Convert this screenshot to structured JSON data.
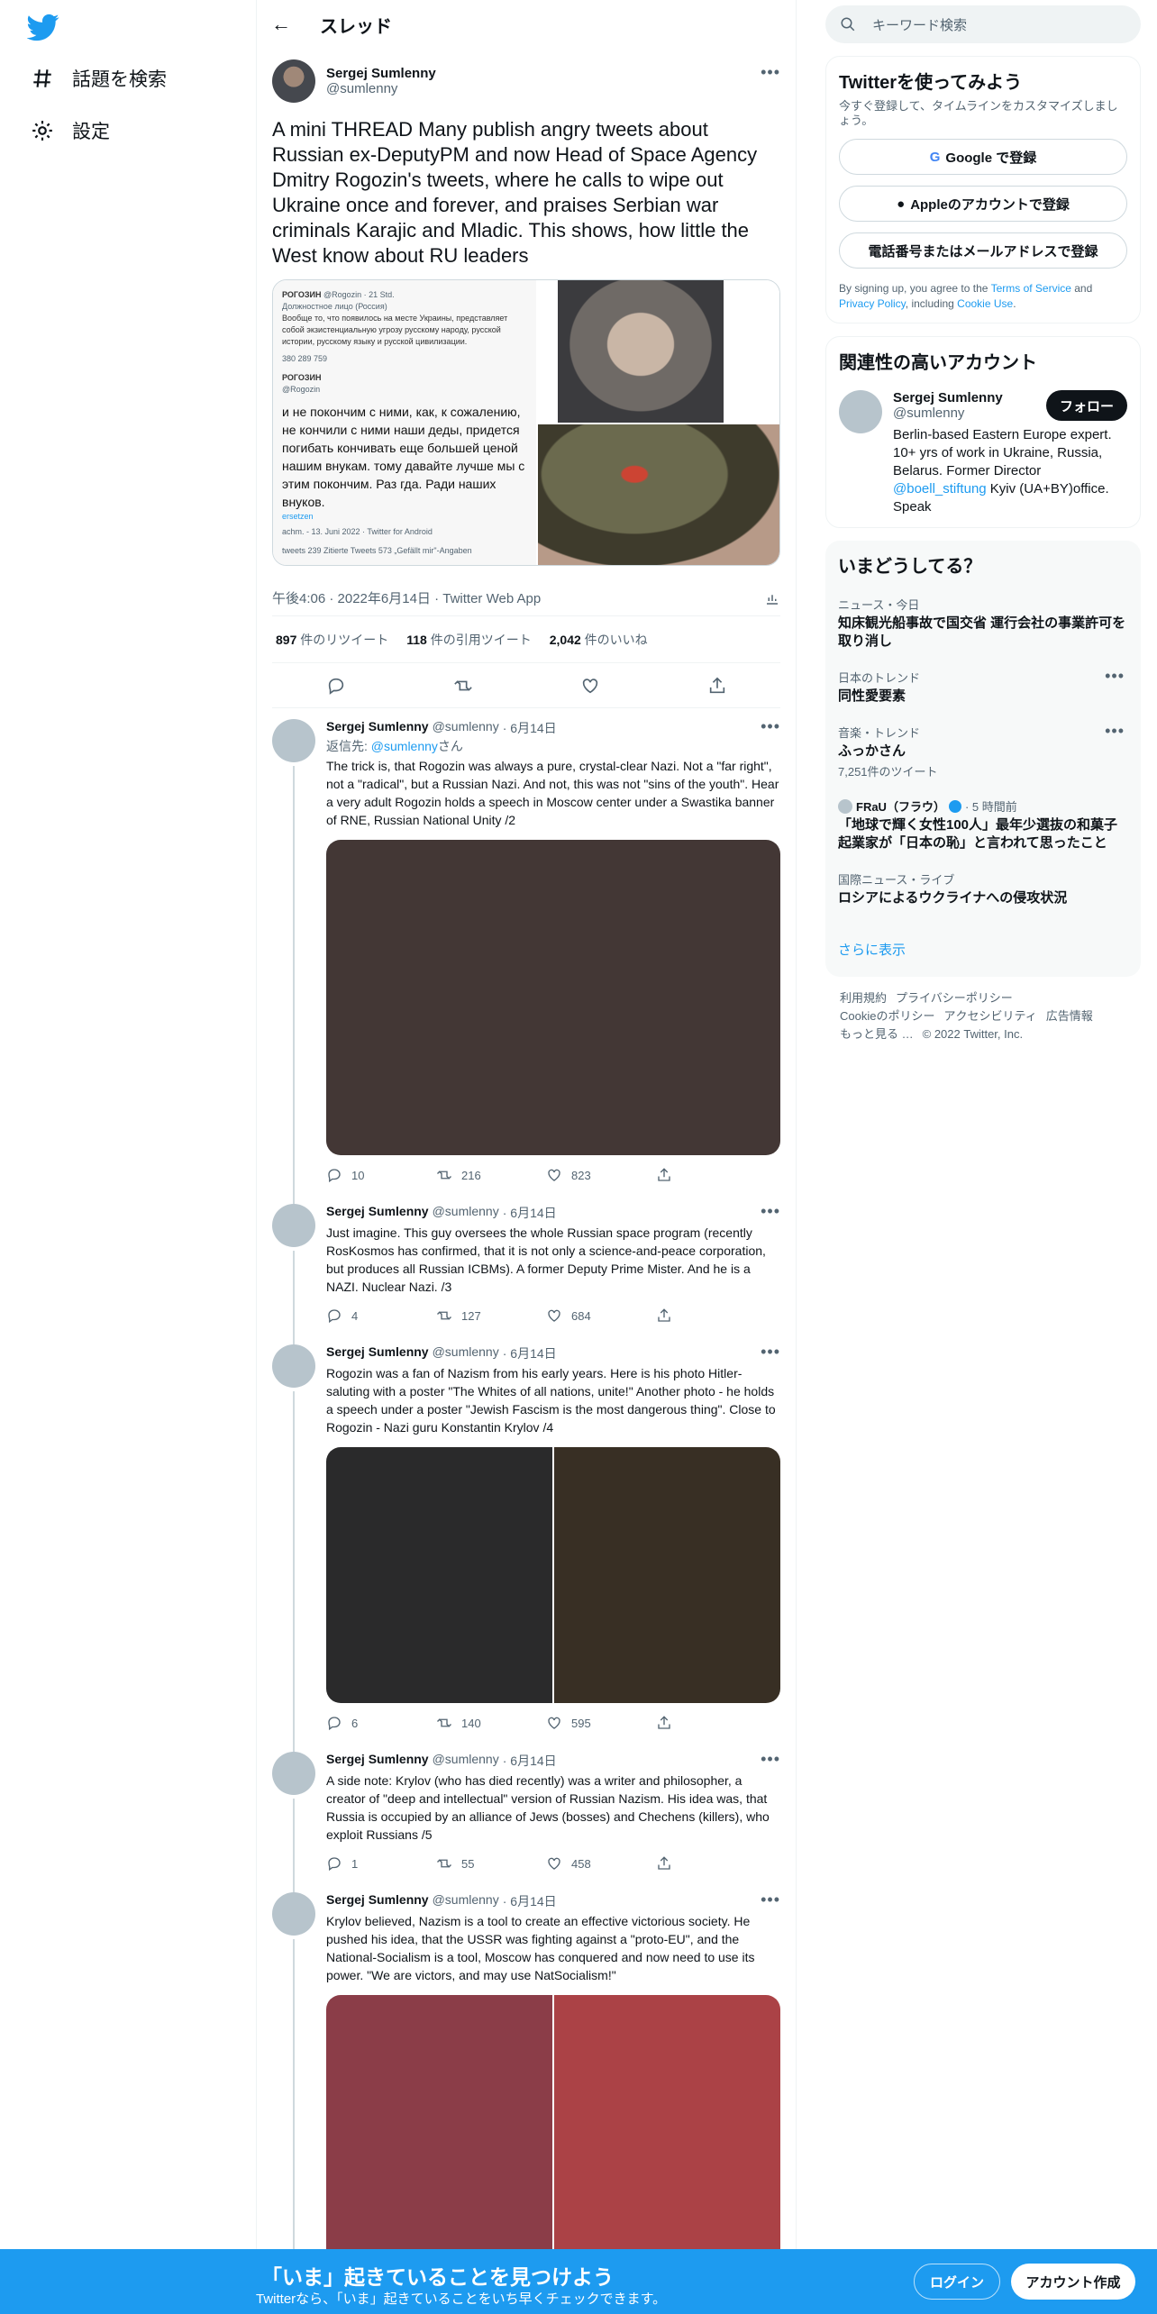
{
  "nav": {
    "explore_label": "話題を検索",
    "settings_label": "設定"
  },
  "header": {
    "title": "スレッド"
  },
  "main_tweet": {
    "name": "Sergej Sumlenny",
    "handle": "@sumlenny",
    "text": "A mini THREAD Many publish angry tweets about Russian ex-DeputyPM and now Head of Space Agency Dmitry Rogozin's tweets, where he calls to wipe out Ukraine once and forever, and praises Serbian war criminals Karajic and Mladic. This shows, how little the West know about RU leaders",
    "media_text": {
      "author": "РОГОЗИН",
      "handle_time": "@Rogozin · 21 Std.",
      "label": "Должностное лицо (Россия)",
      "body": "Вообще то, что появилось на месте Украины, представляет собой экзистенциальную угрозу русскому народу, русской истории, русскому языку и русской цивилизации.",
      "counts": "380   289   759",
      "author2": "РОГОЗИН",
      "handle2": "@Rogozin",
      "big": "и не покончим с ними, как, к сожалению, не кончили с ними наши деды, придется погибать кончивать еще большей ценой нашим внукам. тому давайте лучше мы с этим покончим. Раз гда. Ради наших внуков.",
      "link": "ersetzen",
      "date": "achm. - 13. Juni 2022 · Twitter for Android",
      "foot": "tweets   239 Zitierte Tweets   573 „Gefällt mir\"-Angaben"
    },
    "timestamp": "午後4:06 · 2022年6月14日 · Twitter Web App",
    "retweets": "897",
    "retweets_label": "件のリツイート",
    "quotes": "118",
    "quotes_label": "件の引用ツイート",
    "likes": "2,042",
    "likes_label": "件のいいね"
  },
  "replies": [
    {
      "name": "Sergej Sumlenny",
      "handle": "@sumlenny",
      "date": "· 6月14日",
      "replying_prefix": "返信先: ",
      "replying_handle": "@sumlenny",
      "replying_suffix": "さん",
      "text": "The trick is, that Rogozin was always a pure, crystal-clear Nazi. Not a \"far right\", not a \"radical\", but a Russian Nazi. And not, this was not \"sins of the youth\". Hear a very adult Rogozin holds a speech in Moscow center under a Swastika banner of RNE, Russian National Unity /2",
      "reply_count": "10",
      "retweet_count": "216",
      "like_count": "823"
    },
    {
      "name": "Sergej Sumlenny",
      "handle": "@sumlenny",
      "date": "· 6月14日",
      "text": "Just imagine. This guy oversees the whole Russian space program (recently RosKosmos has confirmed, that it is not only a science-and-peace corporation, but produces all Russian ICBMs). A former Deputy Prime Mister. And he is a NAZI. Nuclear Nazi. /3",
      "reply_count": "4",
      "retweet_count": "127",
      "like_count": "684"
    },
    {
      "name": "Sergej Sumlenny",
      "handle": "@sumlenny",
      "date": "· 6月14日",
      "text": "Rogozin was a fan of Nazism from his early years. Here is his photo Hitler-saluting with a poster \"The Whites of all nations, unite!\" Another photo - he holds a speech under a poster \"Jewish Fascism is the most dangerous thing\". Close to Rogozin - Nazi guru Konstantin Krylov /4",
      "reply_count": "6",
      "retweet_count": "140",
      "like_count": "595"
    },
    {
      "name": "Sergej Sumlenny",
      "handle": "@sumlenny",
      "date": "· 6月14日",
      "text": "A side note: Krylov (who has died recently) was a writer and philosopher, a creator of \"deep and intellectual\" version of Russian Nazism. His idea was, that Russia is occupied by an alliance of Jews (bosses) and Chechens (killers), who exploit Russians /5",
      "reply_count": "1",
      "retweet_count": "55",
      "like_count": "458"
    },
    {
      "name": "Sergej Sumlenny",
      "handle": "@sumlenny",
      "date": "· 6月14日",
      "text": "Krylov believed, Nazism is a tool to create an effective victorious society. He pushed his idea, that the USSR was fighting against a \"proto-EU\", and the National-Socialism is a tool, Moscow has conquered and now need to use its power. \"We are victors, and may use NatSocialism!\""
    }
  ],
  "right": {
    "search_placeholder": "キーワード検索",
    "signup": {
      "title": "Twitterを使ってみよう",
      "subtitle": "今すぐ登録して、タイムラインをカスタマイズしましょう。",
      "google": "Google で登録",
      "apple": "Appleのアカウントで登録",
      "phone": "電話番号またはメールアドレスで登録",
      "legal_prefix": "By signing up, you agree to the ",
      "terms": "Terms of Service",
      "and": " and ",
      "privacy": "Privacy Policy",
      "including": ", including ",
      "cookie": "Cookie Use",
      "period": "."
    },
    "related": {
      "title": "関連性の高いアカウント",
      "name": "Sergej Sumlenny",
      "handle": "@sumlenny",
      "follow": "フォロー",
      "bio_a": "Berlin-based      Eastern Europe expert. 10+ yrs of work in Ukraine, Russia, Belarus. Former Director ",
      "bio_link": "@boell_stiftung",
      "bio_b": " Kyiv (UA+BY)office. Speak"
    },
    "trends": {
      "title": "いまどうしてる？",
      "items": [
        {
          "category": "ニュース・今日",
          "title": "知床観光船事故で国交省 運行会社の事業許可を取り消し"
        },
        {
          "category": "日本のトレンド",
          "title": "同性愛要素"
        },
        {
          "category": "音楽・トレンド",
          "title": "ふっかさん",
          "count": "7,251件のツイート"
        },
        {
          "category": "FRaU（フラウ）",
          "time": "· 5 時間前",
          "title": "「地球で輝く女性100人」最年少選抜の和菓子起業家が「日本の恥」と言われて思ったこと"
        },
        {
          "category": "国際ニュース・ライブ",
          "title": "ロシアによるウクライナへの侵攻状況"
        }
      ],
      "show_more": "さらに表示"
    },
    "footer": {
      "terms": "利用規約",
      "privacy": "プライバシーポリシー",
      "cookie": "Cookieのポリシー",
      "access": "アクセシビリティ",
      "ads": "広告情報",
      "more": "もっと見る …",
      "copyright": "© 2022 Twitter, Inc."
    }
  },
  "bottom_bar": {
    "headline": "「いま」起きていることを見つけよう",
    "subline": "Twitterなら、「いま」起きていることをいち早くチェックできます。",
    "login": "ログイン",
    "create": "アカウント作成"
  },
  "colors": {
    "accent": "#1d9bf0",
    "media_2": "#433735",
    "media_4a": "#2a2a2b",
    "media_4b": "#382f24",
    "media_6a": "#8b3d48",
    "media_6b": "#ab4246"
  }
}
